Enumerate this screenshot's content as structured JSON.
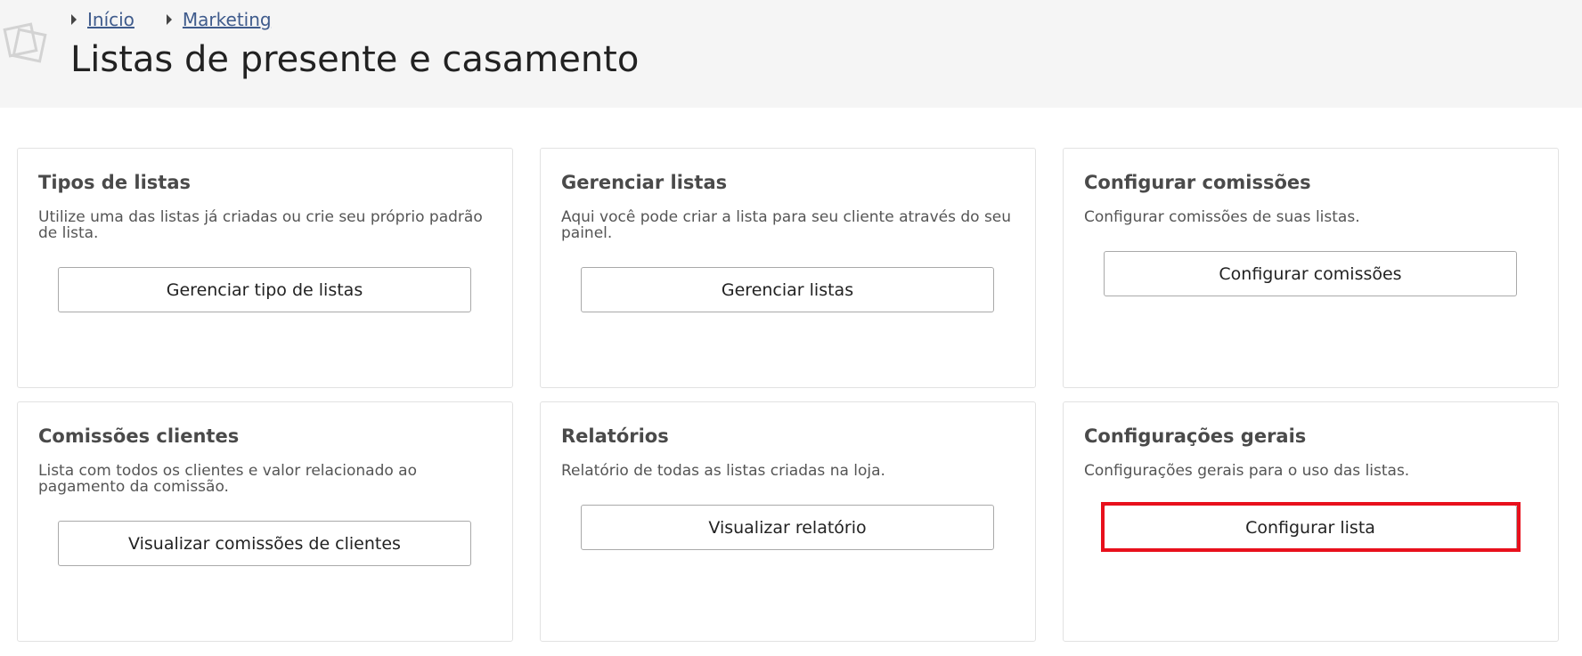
{
  "breadcrumb": {
    "items": [
      {
        "label": "Início"
      },
      {
        "label": "Marketing"
      }
    ]
  },
  "page": {
    "title": "Listas de presente e casamento"
  },
  "cards": [
    {
      "title": "Tipos de listas",
      "description": "Utilize uma das listas já criadas ou crie seu próprio padrão de lista.",
      "button": "Gerenciar tipo de listas"
    },
    {
      "title": "Gerenciar listas",
      "description": "Aqui você pode criar a lista para seu cliente através do seu painel.",
      "button": "Gerenciar listas"
    },
    {
      "title": "Configurar comissões",
      "description": "Configurar comissões de suas listas.",
      "button": "Configurar comissões"
    },
    {
      "title": "Comissões clientes",
      "description": "Lista com todos os clientes e valor relacionado ao pagamento da comissão.",
      "button": "Visualizar comissões de clientes"
    },
    {
      "title": "Relatórios",
      "description": "Relatório de todas as listas criadas na loja.",
      "button": "Visualizar relatório"
    },
    {
      "title": "Configurações gerais",
      "description": "Configurações gerais para o uso das listas.",
      "button": "Configurar lista"
    }
  ],
  "colors": {
    "header_bg": "#f5f5f5",
    "link": "#3f5b8c",
    "highlight": "#e8101c"
  },
  "icons": {
    "logo": "stacked-squares-logo-icon",
    "breadcrumb_separator": "caret-right-icon"
  }
}
